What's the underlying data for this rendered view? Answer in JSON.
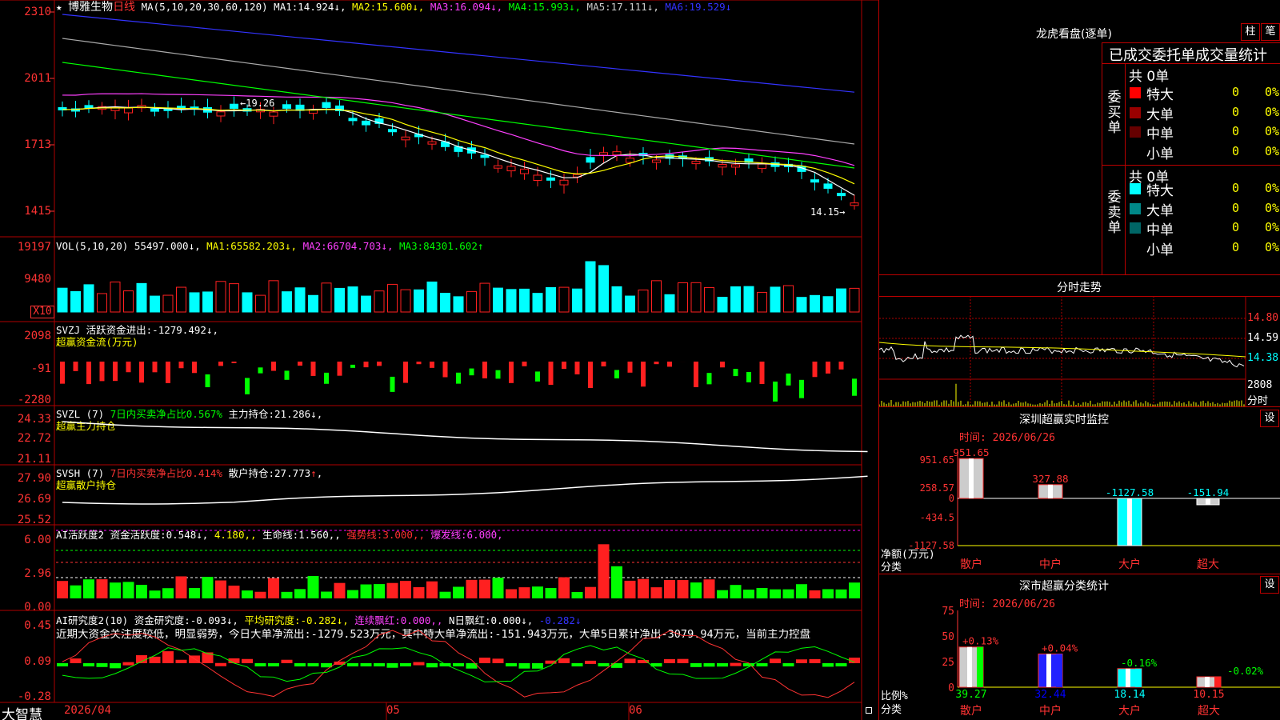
{
  "app": {
    "name": "大智慧",
    "stock": "博雅生物",
    "period": "日线",
    "star": "★"
  },
  "colors": {
    "up": "#ff2020",
    "down": "#00ffff",
    "frame": "#b00000",
    "ma1": "#ffffff",
    "ma2": "#ffff00",
    "ma3": "#ff40ff",
    "ma4": "#00ff00",
    "ma5": "#aaaaaa",
    "ma6": "#3333ff"
  },
  "main": {
    "ma_title": "MA(5,10,20,30,60,120)",
    "ma": [
      {
        "label": "MA1:",
        "value": "14.924",
        "arrow": "↓",
        "color": "#ffffff"
      },
      {
        "label": "MA2:",
        "value": "15.600",
        "arrow": "↓",
        "color": "#ffff00"
      },
      {
        "label": "MA3:",
        "value": "16.094",
        "arrow": "↓",
        "color": "#ff40ff"
      },
      {
        "label": "MA4:",
        "value": "15.993",
        "arrow": "↓",
        "color": "#00ff00"
      },
      {
        "label": "MA5:",
        "value": "17.111",
        "arrow": "↓",
        "color": "#cccccc"
      },
      {
        "label": "MA6:",
        "value": "19.529",
        "arrow": "↓",
        "color": "#3333ff"
      }
    ],
    "yticks": [
      "2310",
      "2011",
      "1713",
      "1415"
    ],
    "high_label": "19.26",
    "low_label": "14.15"
  },
  "vol": {
    "title": "VOL(5,10,20)",
    "value": "55497.000",
    "arrow": "↓",
    "ma": [
      {
        "label": "MA1:",
        "value": "65582.203",
        "arrow": "↓",
        "color": "#ffff00"
      },
      {
        "label": "MA2:",
        "value": "66704.703",
        "arrow": "↓",
        "color": "#ff40ff"
      },
      {
        "label": "MA3:",
        "value": "84301.602",
        "arrow": "↑",
        "color": "#00ff00"
      }
    ],
    "yticks": [
      "19197",
      "9480"
    ],
    "unit": "X10"
  },
  "svzj": {
    "title": "SVZJ",
    "label": "活跃资金进出:",
    "value": "-1279.492",
    "arrow": "↓",
    "sub": "超赢资金流(万元)",
    "yticks": [
      "2098",
      "-91",
      "-2280"
    ]
  },
  "svzl": {
    "title": "SVZL (7)",
    "desc": "7日内买卖净占比0.567%",
    "label": "主力持仓:",
    "value": "21.286",
    "arrow": "↓",
    "sub": "超赢主力持仓",
    "yticks": [
      "24.33",
      "22.72",
      "21.11"
    ]
  },
  "svsh": {
    "title": "SVSH (7)",
    "desc": "7日内买卖净占比0.414%",
    "label": "散户持仓:",
    "value": "27.773",
    "arrow": "↑",
    "sub": "超赢散户持仓",
    "yticks": [
      "27.90",
      "26.69",
      "25.52"
    ]
  },
  "ai1": {
    "title": "AI活跃度2",
    "items": [
      {
        "label": "资金活跃度:",
        "value": "0.548",
        "arrow": "↓",
        "color": "#ffffff"
      },
      {
        "label": "",
        "value": "4.180",
        "arrow": ",",
        "color": "#ffff00"
      },
      {
        "label": "生命线:",
        "value": "1.560",
        "arrow": ",",
        "color": "#ffffff"
      },
      {
        "label": "强势线:",
        "value": "3.000",
        "arrow": ",",
        "color": "#ff3030"
      },
      {
        "label": "爆发线:",
        "value": "6.000",
        "arrow": ",",
        "color": "#ff40ff"
      }
    ],
    "yticks": [
      "6.00",
      "2.96",
      "0.00"
    ]
  },
  "ai2": {
    "title": "AI研究度2(10)",
    "items": [
      {
        "label": "资金研究度:",
        "value": "-0.093",
        "arrow": "↓",
        "color": "#ffffff"
      },
      {
        "label": "平均研究度:",
        "value": "-0.282",
        "arrow": "↓",
        "color": "#ffff00"
      },
      {
        "label": "连续飘红:",
        "value": "0.000",
        "arrow": ",",
        "color": "#ff40ff"
      },
      {
        "label": "N日飘红:",
        "value": "0.000",
        "arrow": "↓",
        "color": "#ffffff"
      },
      {
        "label": "",
        "value": "-0.282",
        "arrow": "↓",
        "color": "#3333ff"
      }
    ],
    "note": "近期大资金关注度较低，明显弱势，今日大单净流出:-1279.523万元，其中特大单净流出:-151.943万元，大单5日累计净出-3079.94万元，当前主力控盘",
    "yticks": [
      "0.45",
      "0.09",
      "-0.28"
    ]
  },
  "dates": [
    "2026/04",
    "05",
    "06"
  ],
  "lhb": {
    "title": "龙虎看盘(逐单)",
    "btn1": "柱",
    "btn2": "笔",
    "header": "已成交委托单成交量统计",
    "buy_label": "委买单",
    "sell_label": "委卖单",
    "buy_total": "共 0单",
    "sell_total": "共 0单",
    "buy_rows": [
      {
        "name": "特大",
        "count": "0",
        "pct": "0%",
        "color": "#ff0000"
      },
      {
        "name": "大单",
        "count": "0",
        "pct": "0%",
        "color": "#990000"
      },
      {
        "name": "中单",
        "count": "0",
        "pct": "0%",
        "color": "#660000"
      },
      {
        "name": "小单",
        "count": "0",
        "pct": "0%",
        "color": ""
      }
    ],
    "sell_rows": [
      {
        "name": "特大",
        "count": "0",
        "pct": "0%",
        "color": "#00ffff"
      },
      {
        "name": "大单",
        "count": "0",
        "pct": "0%",
        "color": "#008888"
      },
      {
        "name": "中单",
        "count": "0",
        "pct": "0%",
        "color": "#006666"
      },
      {
        "name": "小单",
        "count": "0",
        "pct": "0%",
        "color": ""
      }
    ]
  },
  "fenshi": {
    "title": "分时走势",
    "yticks": [
      "14.80",
      "14.59",
      "14.38"
    ],
    "vol_label": "2808",
    "sub": "分时"
  },
  "monitor": {
    "title": "深圳超赢实时监控",
    "set_btn": "设",
    "time": "时间: 2026/06/26",
    "yticks": [
      "951.65",
      "258.57",
      "0",
      "-434.5",
      "-1127.58"
    ],
    "ylabel": "净额(万元)",
    "xlabel": "分类",
    "categories": [
      "散户",
      "中户",
      "大户",
      "超大"
    ],
    "values": [
      951.65,
      327.88,
      -1127.58,
      -151.94
    ],
    "value_labels": [
      "951.65",
      "327.88",
      "-1127.58",
      "-151.94"
    ]
  },
  "classify": {
    "title": "深市超赢分类统计",
    "set_btn": "设",
    "time": "时间: 2026/06/26",
    "yticks": [
      "75",
      "50",
      "25",
      "0"
    ],
    "ylabel": "比例%",
    "xlabel": "分类",
    "categories": [
      "散户",
      "中户",
      "大户",
      "超大"
    ],
    "values": [
      39.27,
      32.44,
      18.14,
      10.15
    ],
    "value_labels": [
      "39.27",
      "32.44",
      "18.14",
      "10.15"
    ],
    "changes": [
      "+0.13%",
      "+0.04%",
      "-0.16%",
      "-0.02%"
    ]
  }
}
